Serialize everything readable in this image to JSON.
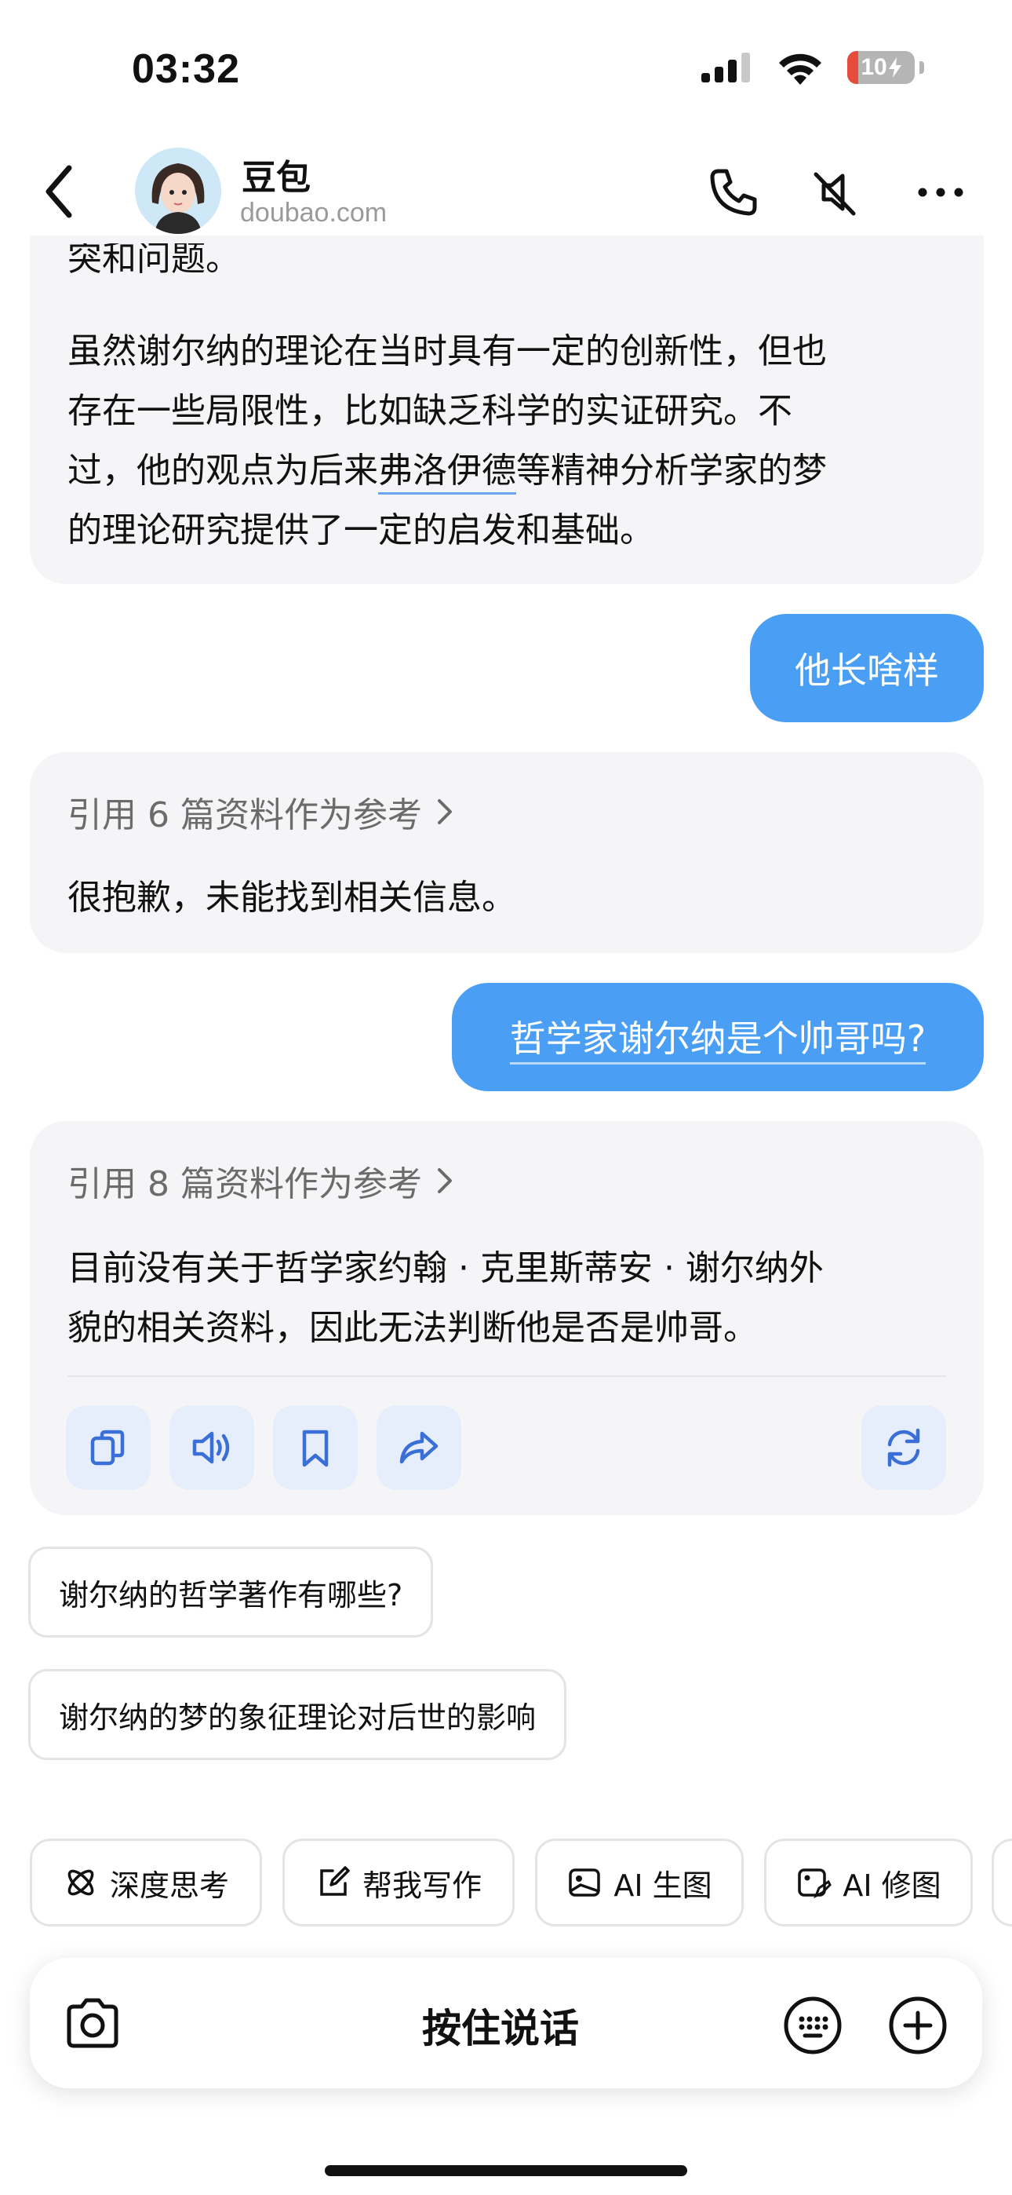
{
  "status_bar": {
    "time": "03:32",
    "battery": "10"
  },
  "header": {
    "name": "豆包",
    "domain": "doubao.com"
  },
  "messages": {
    "partial_top": "突和问题。",
    "para_line1": "虽然谢尔纳的理论在当时具有一定的创新性，但也",
    "para_line2": "存在一些局限性，比如缺乏科学的实证研究。不",
    "para_line3_a": "过，他的观点为后来",
    "para_line3_link": "弗洛伊德",
    "para_line3_b": "等精神分析学家的梦",
    "para_line4": "的理论研究提供了一定的启发和基础。",
    "user1": "他长啥样",
    "ref1": "引用 6 篇资料作为参考",
    "reply1": "很抱歉，未能找到相关信息。",
    "user2": "哲学家谢尔纳是个帅哥吗?",
    "ref2": "引用 8 篇资料作为参考",
    "reply2_line1": "目前没有关于哲学家约翰 · 克里斯蒂安 · 谢尔纳外",
    "reply2_line2": "貌的相关资料，因此无法判断他是否是帅哥。"
  },
  "suggestions": [
    "谢尔纳的哲学著作有哪些?",
    "谢尔纳的梦的象征理论对后世的影响"
  ],
  "tools": [
    "深度思考",
    "帮我写作",
    "AI 生图",
    "AI 修图"
  ],
  "input": {
    "hold_to_talk": "按住说话"
  },
  "colors": {
    "accent": "#4a9ff5",
    "card_bg": "#f5f5f7",
    "action_bg": "#e6eefb"
  }
}
